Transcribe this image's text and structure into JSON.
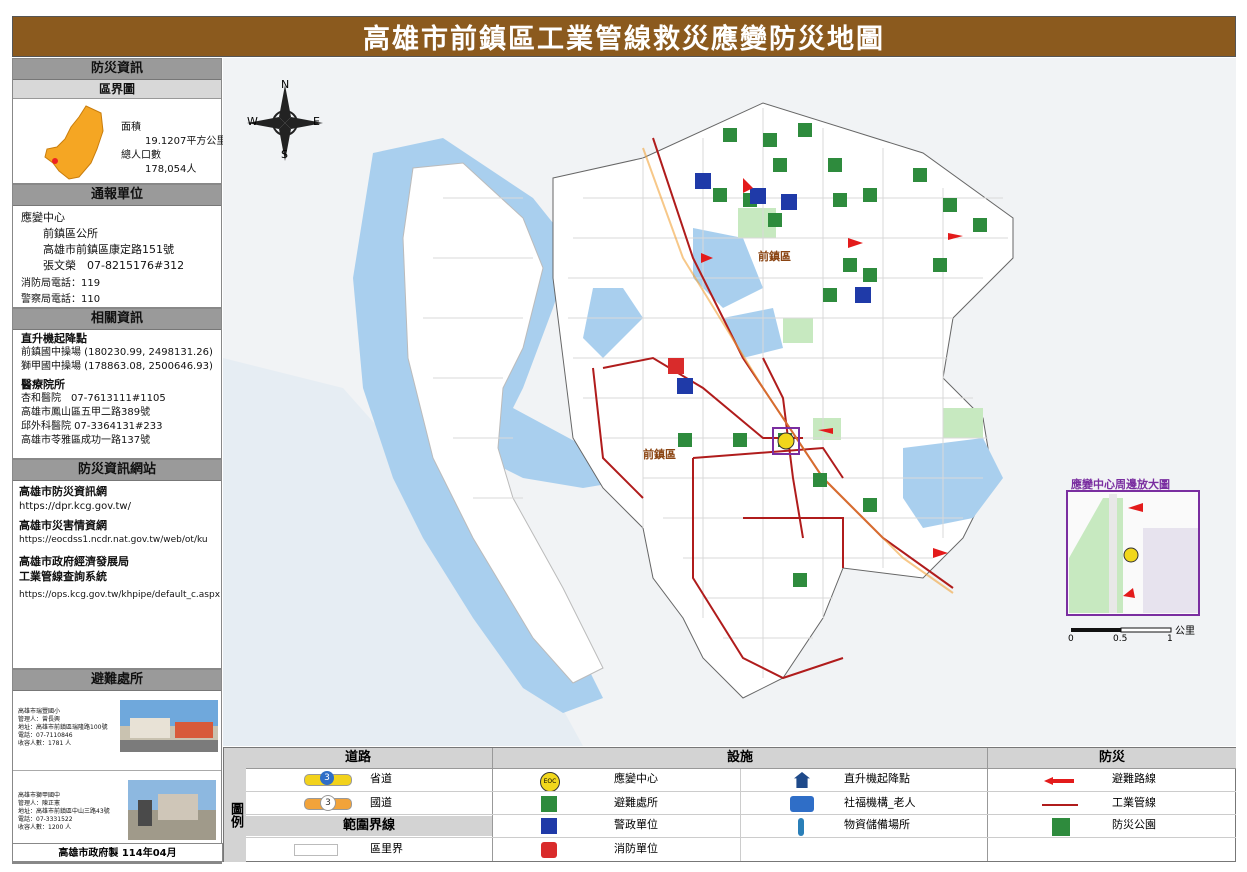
{
  "title": "高雄市前鎮區工業管線救災應變防災地圖",
  "sidebar": {
    "disaster_info_header": "防災資訊",
    "district_map_header": "區界圖",
    "area_label": "面積",
    "area_value": "19.1207平方公里",
    "population_label": "總人口數",
    "population_value": "178,054人",
    "report_header": "通報單位",
    "eoc_title": "應變中心",
    "eoc_name": "前鎮區公所",
    "eoc_address": "高雄市前鎮區康定路151號",
    "eoc_contact": "張文榮　07-8215176#312",
    "fire_phone": "消防局電話：119",
    "police_phone": "警察局電話：110",
    "related_header": "相關資訊",
    "heli_title": "直升機起降點",
    "heli_1": "前鎮國中操場 (180230.99, 2498131.26)",
    "heli_2": "獅甲國中操場 (178863.08, 2500646.93)",
    "hospital_title": "醫療院所",
    "hosp_1": "杏和醫院　07-7613111#1105",
    "hosp_1_addr": "高雄市鳳山區五甲二路389號",
    "hosp_2": "邱外科醫院  07-3364131#233",
    "hosp_2_addr": "高雄市苓雅區成功一路137號",
    "web_header": "防災資訊網站",
    "web_1_title": "高雄市防災資訊網",
    "web_1_url": "https://dpr.kcg.gov.tw/",
    "web_2_title": "高雄市災害情資網",
    "web_2_url": "https://eocdss1.ncdr.nat.gov.tw/web/ot/ku",
    "web_3_title_a": "高雄市政府經濟發展局",
    "web_3_title_b": "工業管線查詢系統",
    "web_3_url": "https://ops.kcg.gov.tw/khpipe/default_c.aspx",
    "shelter_header": "避難處所",
    "shelter_1": [
      "高雄市瑞豐國小",
      "管理人：曾長興",
      "地址：高雄市前鎮區瑞隆路100號",
      "電話：07-7110846",
      "收容人數：1781 人"
    ],
    "shelter_2": [
      "高雄市獅甲國中",
      "管理人：陳正憲",
      "地址：高雄市前鎮區中山三路43號",
      "電話：07-3331522",
      "收容人數：1200 人"
    ],
    "footer": "高雄市政府製 114年04月"
  },
  "map": {
    "district_label_1": "前鎮區",
    "district_label_2": "前鎮區",
    "inset_title": "應變中心周邊放大圖",
    "scale_0": "0",
    "scale_1": "0.5",
    "scale_2": "1",
    "scale_unit": "公里",
    "compass_n": "N",
    "compass_s": "S",
    "compass_e": "E",
    "compass_w": "W"
  },
  "legend": {
    "side_label": "圖例",
    "road_header": "道路",
    "facility_header": "設施",
    "disaster_header": "防災",
    "boundary_header": "範圍界線",
    "provincial_road": "省道",
    "national_road": "國道",
    "village_boundary": "區里界",
    "eoc": "應變中心",
    "shelter": "避難處所",
    "police": "警政單位",
    "fire": "消防單位",
    "heli": "直升機起降點",
    "welfare": "社福機構_老人",
    "storage": "物資儲備場所",
    "evac_route": "避難路線",
    "pipeline": "工業管線",
    "park": "防災公園",
    "road3": "3",
    "eoc_badge": "EOC"
  },
  "colors": {
    "title_bg": "#8B5A1E",
    "pipeline": "#b01c1c",
    "evac_arrow": "#e31b1b",
    "shelter_green": "#2e8b3d",
    "police_blue": "#1f3aa8",
    "water": "#a9cfee",
    "inset_border": "#7a2ea0"
  }
}
